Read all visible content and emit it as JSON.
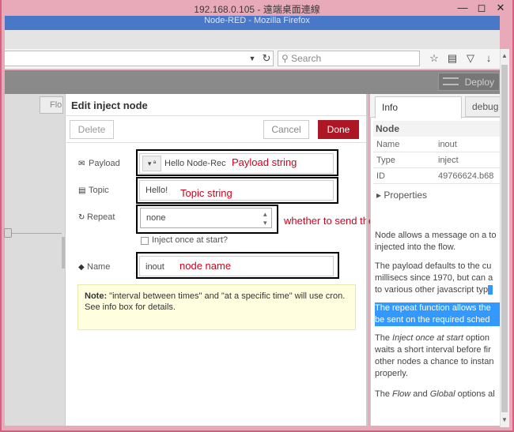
{
  "remote_desktop": {
    "title": "192.168.0.105 - 遠端桌面連線"
  },
  "browser": {
    "title": "Node-RED - Mozilla Firefox",
    "search_placeholder": "Search",
    "refresh_icon": "refresh-icon",
    "dropdown_icon": "chevron-down-icon"
  },
  "nodered": {
    "deploy_label": "Deploy",
    "workspace_tab": "Flo"
  },
  "editor": {
    "title": "Edit inject node",
    "delete_label": "Delete",
    "cancel_label": "Cancel",
    "done_label": "Done",
    "payload_label": "Payload",
    "payload_value": "Hello Node-Rec",
    "topic_label": "Topic",
    "topic_value": "Hello!",
    "repeat_label": "Repeat",
    "repeat_value": "none",
    "once_label": "Inject once at start?",
    "name_label": "Name",
    "name_value": "inout",
    "tip_bold": "Note:",
    "tip_text": " \"interval between times\" and \"at a specific time\" will use cron.",
    "tip_text2": "See info box for details."
  },
  "annotations": {
    "payload": "Payload string",
    "topic": "Topic string",
    "repeat": "whether to send the message repeatedly?",
    "name": "node name"
  },
  "sidebar": {
    "tab_info": "Info",
    "tab_debug": "debug",
    "node_heading": "Node",
    "rows": [
      {
        "key": "Name",
        "value": "inout"
      },
      {
        "key": "Type",
        "value": "inject"
      },
      {
        "key": "ID",
        "value": "49766624.b68"
      }
    ],
    "properties_label": "Properties",
    "p1_a": "Node allows a message on a to",
    "p1_b": "injected into the flow.",
    "p2_a": "The payload defaults to the cu",
    "p2_b": "millisecs since 1970, but can a",
    "p2_c": "to various other javascript typ",
    "p3_a": "The repeat function allows the",
    "p3_b": "be sent on the required sched",
    "p4_a_pre": "The ",
    "p4_a_em": "Inject once at start",
    "p4_a_post": " option",
    "p4_b": "waits a short interval before fir",
    "p4_c": "other nodes a chance to instan",
    "p4_d": "properly.",
    "p5_pre": "The ",
    "p5_em1": "Flow",
    "p5_mid": " and ",
    "p5_em2": "Global",
    "p5_post": " options al"
  }
}
